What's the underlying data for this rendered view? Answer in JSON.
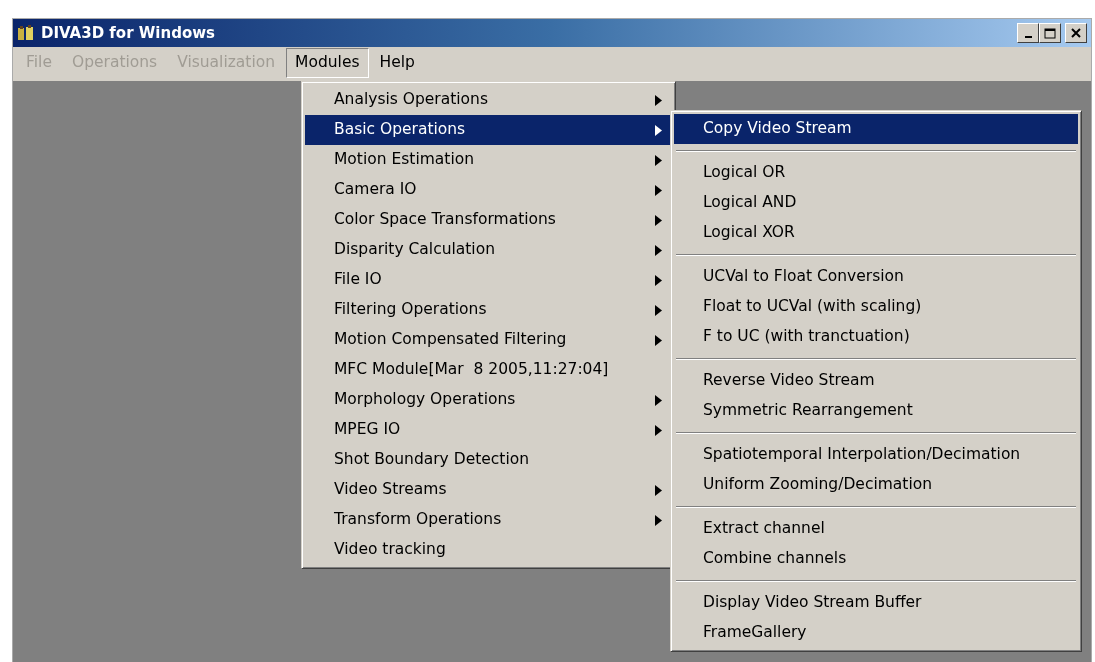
{
  "window": {
    "title": "DIVA3D for Windows"
  },
  "menu_bar": [
    {
      "label": "File",
      "disabled": true,
      "selected": false
    },
    {
      "label": "Operations",
      "disabled": true,
      "selected": false
    },
    {
      "label": "Visualization",
      "disabled": true,
      "selected": false
    },
    {
      "label": "Modules",
      "disabled": false,
      "selected": true
    },
    {
      "label": "Help",
      "disabled": false,
      "selected": false
    }
  ],
  "modules_menu": [
    {
      "label": "Analysis Operations",
      "submenu": true,
      "selected": false
    },
    {
      "label": "Basic Operations",
      "submenu": true,
      "selected": true
    },
    {
      "label": "Motion Estimation",
      "submenu": true,
      "selected": false
    },
    {
      "label": "Camera IO",
      "submenu": true,
      "selected": false
    },
    {
      "label": "Color Space Transformations",
      "submenu": true,
      "selected": false
    },
    {
      "label": "Disparity Calculation",
      "submenu": true,
      "selected": false
    },
    {
      "label": "File IO",
      "submenu": true,
      "selected": false
    },
    {
      "label": "Filtering Operations",
      "submenu": true,
      "selected": false
    },
    {
      "label": "Motion Compensated Filtering",
      "submenu": true,
      "selected": false
    },
    {
      "label": "MFC Module[Mar  8 2005,11:27:04]",
      "submenu": false,
      "selected": false
    },
    {
      "label": "Morphology Operations",
      "submenu": true,
      "selected": false
    },
    {
      "label": "MPEG IO",
      "submenu": true,
      "selected": false
    },
    {
      "label": "Shot Boundary Detection",
      "submenu": false,
      "selected": false
    },
    {
      "label": "Video Streams",
      "submenu": true,
      "selected": false
    },
    {
      "label": "Transform Operations",
      "submenu": true,
      "selected": false
    },
    {
      "label": "Video tracking",
      "submenu": false,
      "selected": false
    }
  ],
  "basic_operations_submenu": [
    [
      {
        "label": "Copy Video Stream",
        "selected": true
      }
    ],
    [
      {
        "label": "Logical OR",
        "selected": false
      },
      {
        "label": "Logical AND",
        "selected": false
      },
      {
        "label": "Logical XOR",
        "selected": false
      }
    ],
    [
      {
        "label": "UCVal to Float Conversion",
        "selected": false
      },
      {
        "label": "Float to UCVal (with scaling)",
        "selected": false
      },
      {
        "label": "F to UC (with tranctuation)",
        "selected": false
      }
    ],
    [
      {
        "label": "Reverse Video Stream",
        "selected": false
      },
      {
        "label": "Symmetric Rearrangement",
        "selected": false
      }
    ],
    [
      {
        "label": "Spatiotemporal Interpolation/Decimation",
        "selected": false
      },
      {
        "label": "Uniform Zooming/Decimation",
        "selected": false
      }
    ],
    [
      {
        "label": "Extract channel",
        "selected": false
      },
      {
        "label": "Combine channels",
        "selected": false
      }
    ],
    [
      {
        "label": "Display Video Stream Buffer",
        "selected": false
      },
      {
        "label": "FrameGallery",
        "selected": false
      }
    ]
  ]
}
